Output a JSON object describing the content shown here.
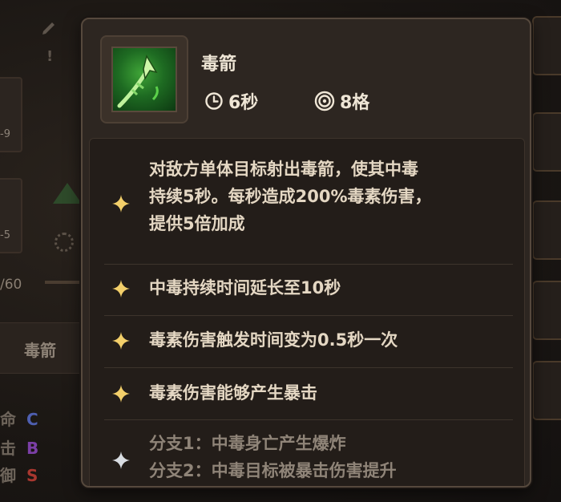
{
  "background": {
    "skill_label": "毒箭",
    "stat_fraction": "/60",
    "card_badges": [
      "-9",
      "-5"
    ],
    "attributes": [
      {
        "name": "命",
        "grade": "C",
        "color": "#4e5fb0"
      },
      {
        "name": "击",
        "grade": "B",
        "color": "#7b3fa6"
      },
      {
        "name": "御",
        "grade": "S",
        "color": "#a8372f"
      }
    ]
  },
  "tooltip": {
    "skill_name": "毒箭",
    "icon": "poison-arrow-icon",
    "cooldown": "6秒",
    "range": "8格",
    "effects": [
      {
        "lines": [
          "对敌方单体目标射出毒箭，使其中毒",
          "持续5秒。每秒造成200%毒素伤害，",
          "提供5倍加成"
        ],
        "star": "gold"
      },
      {
        "lines": [
          "中毒持续时间延长至10秒"
        ],
        "star": "gold"
      },
      {
        "lines": [
          "毒素伤害触发时间变为0.5秒一次"
        ],
        "star": "gold"
      },
      {
        "lines": [
          "毒素伤害能够产生暴击"
        ],
        "star": "gold"
      },
      {
        "lines": [
          "分支1：中毒身亡产生爆炸",
          "分支2：中毒目标被暴击伤害提升"
        ],
        "star": "silver"
      }
    ],
    "colors": {
      "star_gold": "#f3cf6a",
      "star_silver": "#d9dde2",
      "border": "#56493d"
    }
  }
}
